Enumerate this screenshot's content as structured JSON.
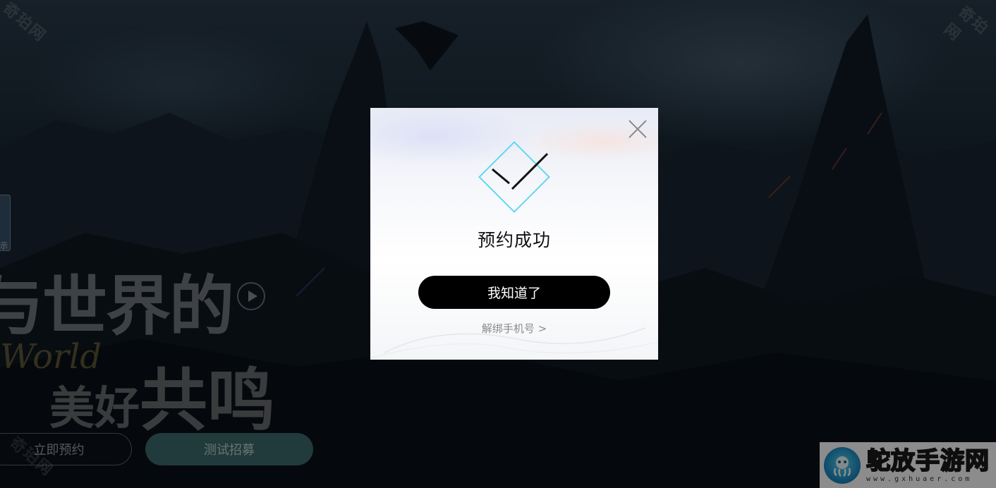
{
  "watermark": {
    "text": "奇珀网"
  },
  "hero": {
    "line1": "与世界的",
    "line2_a": "美好",
    "line2_b": "共鸣",
    "script": "World"
  },
  "side_tab": {
    "label": "示"
  },
  "buttons": {
    "reserve": "立即预约",
    "recruit": "测试招募"
  },
  "modal": {
    "title": "预约成功",
    "confirm_label": "我知道了",
    "unbind_label": "解绑手机号 >"
  },
  "corner_logo": {
    "name": "鸵放手游网",
    "url": "www.gxhuaer.com"
  },
  "colors": {
    "badge_stroke": "#5fd8f0",
    "confirm_bg": "#000000",
    "recruit_bg": "#3d6b6c"
  }
}
